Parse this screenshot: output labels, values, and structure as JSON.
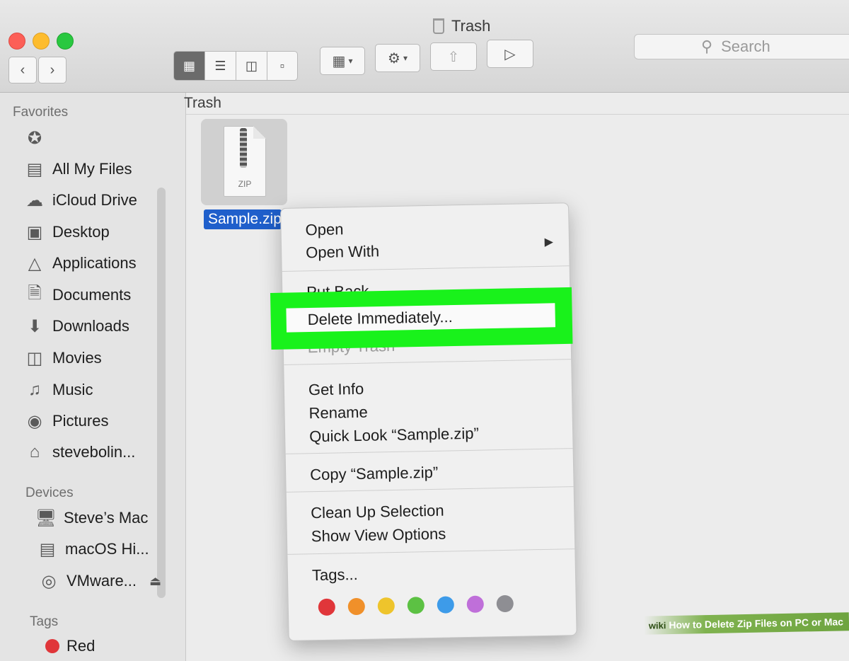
{
  "window": {
    "title": "Trash"
  },
  "toolbar": {
    "back_icon": "chevron-left-icon",
    "forward_icon": "chevron-right-icon",
    "view_modes": [
      "icon-view-icon",
      "list-view-icon",
      "column-view-icon",
      "cover-flow-icon"
    ],
    "search_placeholder": "Search"
  },
  "sidebar": {
    "favorites_header": "Favorites",
    "favorites": [
      {
        "label": "",
        "icon": "airdrop-icon"
      },
      {
        "label": "All My Files",
        "icon": "all-files-icon"
      },
      {
        "label": "iCloud Drive",
        "icon": "cloud-icon"
      },
      {
        "label": "Desktop",
        "icon": "desktop-icon"
      },
      {
        "label": "Applications",
        "icon": "applications-icon"
      },
      {
        "label": "Documents",
        "icon": "documents-icon"
      },
      {
        "label": "Downloads",
        "icon": "downloads-icon"
      },
      {
        "label": "Movies",
        "icon": "movies-icon"
      },
      {
        "label": "Music",
        "icon": "music-icon"
      },
      {
        "label": "Pictures",
        "icon": "camera-icon"
      },
      {
        "label": "stevebolin...",
        "icon": "home-icon"
      }
    ],
    "devices_header": "Devices",
    "devices": [
      {
        "label": "Steve’s Mac",
        "icon": "computer-icon"
      },
      {
        "label": "macOS Hi...",
        "icon": "drive-icon"
      },
      {
        "label": "VMware...",
        "icon": "disc-icon"
      }
    ],
    "tags_header": "Tags",
    "tags": [
      {
        "label": "Red",
        "color": "#e0363a"
      }
    ]
  },
  "content": {
    "path_label": "Trash",
    "file": {
      "name": "Sample.zip",
      "badge": "ZIP"
    }
  },
  "context_menu": {
    "items": {
      "open": "Open",
      "open_with": "Open With",
      "put_back": "Put Back",
      "delete_immediately": "Delete Immediately...",
      "empty_trash": "Empty Trash",
      "get_info": "Get Info",
      "rename": "Rename",
      "quick_look": "Quick Look “Sample.zip”",
      "copy": "Copy “Sample.zip”",
      "clean_up": "Clean Up Selection",
      "show_view_options": "Show View Options",
      "tags": "Tags..."
    },
    "tag_colors": [
      "#e0363a",
      "#f0902a",
      "#eec42c",
      "#5cc143",
      "#3d9be9",
      "#bf6fd9",
      "#8e8e93"
    ]
  },
  "highlight_color": "#19f21b",
  "watermark": {
    "brand": "wiki",
    "text": "How to Delete Zip Files on PC or Mac"
  }
}
